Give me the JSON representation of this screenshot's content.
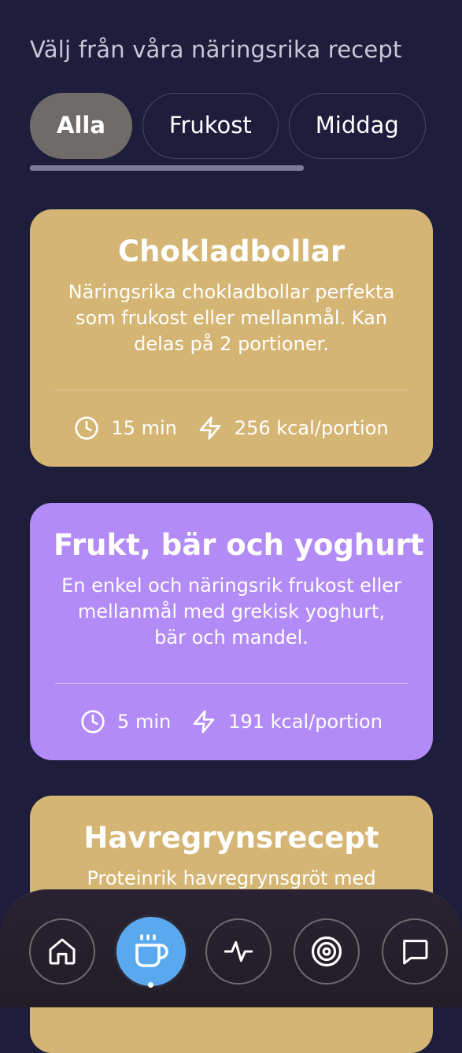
{
  "header": {
    "subtitle": "Välj från våra näringsrika recept"
  },
  "filters": [
    {
      "label": "Alla",
      "active": true
    },
    {
      "label": "Frukost",
      "active": false
    },
    {
      "label": "Middag",
      "active": false
    }
  ],
  "recipes": [
    {
      "title": "Chokladbollar",
      "description": "Näringsrika chokladbollar perfekta som frukost eller mellanmål. Kan delas på 2 portioner.",
      "time": "15 min",
      "calories": "256 kcal/portion",
      "color": "#d4b574"
    },
    {
      "title": "Frukt, bär och yoghurt",
      "description": "En enkel och näringsrik frukost eller mellanmål med grekisk yoghurt, bär och mandel.",
      "time": "5 min",
      "calories": "191 kcal/portion",
      "color": "#b28bf7"
    },
    {
      "title": "Havregrynsrecept",
      "description": "Proteinrik havregrynsgröt med",
      "color": "#d4b574"
    }
  ],
  "nav": {
    "items": [
      {
        "icon": "home-icon"
      },
      {
        "icon": "coffee-cup-icon",
        "active": true
      },
      {
        "icon": "activity-icon"
      },
      {
        "icon": "target-icon"
      },
      {
        "icon": "chat-icon"
      }
    ],
    "active_color": "#5aa9ee"
  }
}
